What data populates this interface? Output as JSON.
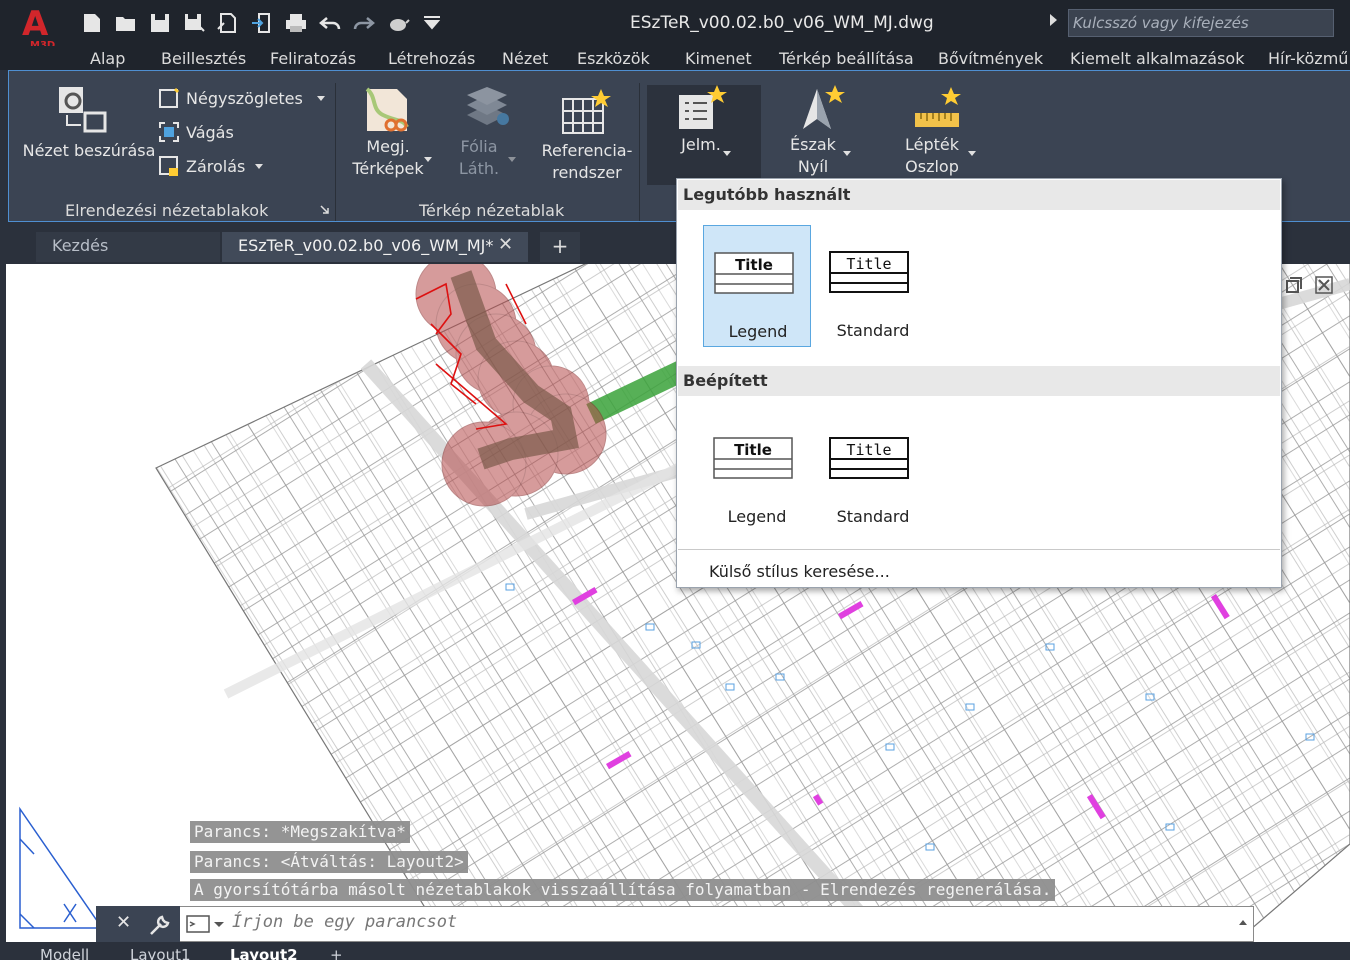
{
  "app": {
    "logo_text": "A",
    "logo_sub": "M3D",
    "document_title": "ESzTeR_v00.02.b0_v06_WM_MJ.dwg",
    "search_placeholder": "Kulcsszó vagy kifejezés"
  },
  "quick_access": {
    "icons": [
      "new-file-icon",
      "open-folder-icon",
      "save-icon",
      "save-as-icon",
      "export-icon",
      "import-icon",
      "print-icon",
      "undo-icon",
      "redo-icon",
      "teapot-icon",
      "customize-icon"
    ]
  },
  "menu_tabs": [
    "Alap",
    "Beillesztés",
    "Feliratozás",
    "Létrehozás",
    "Nézet",
    "Eszközök",
    "Kimenet",
    "Térkép beállítása",
    "Bővítmények",
    "Kiemelt alkalmazások",
    "Hír-közmű"
  ],
  "ribbon": {
    "insert_view": "Nézet beszúrása",
    "rectangular": "Négyszögletes",
    "clip": "Vágás",
    "lock": "Zárolás",
    "panel_layout_viewports": "Elrendezési nézetablakok",
    "map_book_line1": "Megj.",
    "map_book_line2": "Térképek",
    "layer_line1": "Fólia",
    "layer_line2": "Láth.",
    "reference_line1": "Referencia-",
    "reference_line2": "rendszer",
    "panel_map_viewport": "Térkép nézetablak",
    "legend": "Jelm.",
    "north_line1": "Észak",
    "north_line2": "Nyíl",
    "scale_line1": "Lépték",
    "scale_line2": "Oszlop"
  },
  "doc_tabs": {
    "start": "Kezdés",
    "active": "ESzTeR_v00.02.b0_v06_WM_MJ*"
  },
  "dropdown": {
    "recent_header": "Legutóbb használt",
    "builtin_header": "Beépített",
    "recent_items": [
      "Legend",
      "Standard"
    ],
    "builtin_items": [
      "Legend",
      "Standard"
    ],
    "thumb_title": "Title",
    "footer": "Külső stílus keresése..."
  },
  "command": {
    "lines": [
      "Parancs: *Megszakítva*",
      "Parancs:   <Átváltás: Layout2>",
      "A gyorsítótárba másolt nézetablakok visszaállítása folyamatban - Elrendezés regenerálása."
    ],
    "placeholder": "Írjon be egy parancsot"
  },
  "statusbar": {
    "tabs": [
      "Modell",
      "Layout1",
      "Layout2"
    ]
  },
  "colors": {
    "accent": "#4f8fd1",
    "buffer_red": "#b54a4a",
    "road_green": "#3aa33a",
    "magenta": "#e040e0"
  }
}
